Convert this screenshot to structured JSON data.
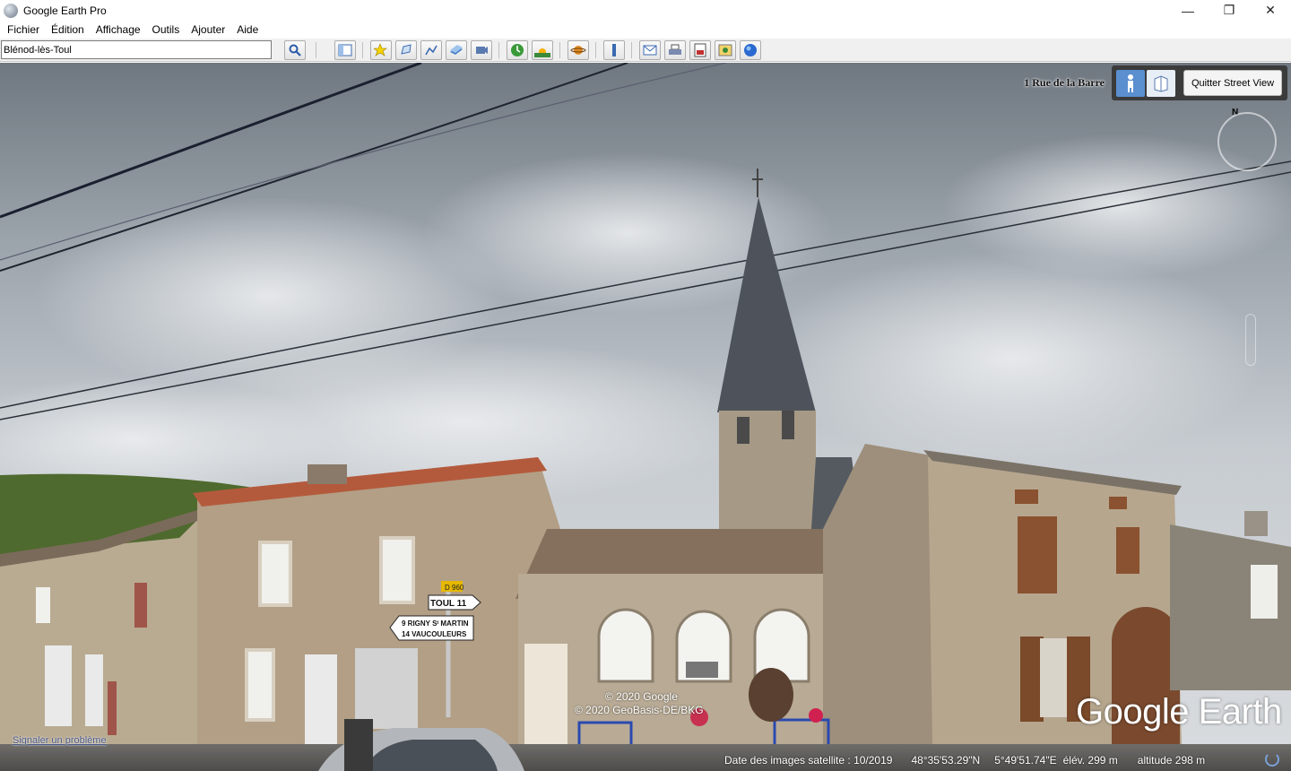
{
  "window": {
    "title": "Google Earth Pro",
    "minimize": "—",
    "restore": "❐",
    "close": "✕"
  },
  "menu": [
    "Fichier",
    "Édition",
    "Affichage",
    "Outils",
    "Ajouter",
    "Aide"
  ],
  "toolbar": {
    "search_value": "Blénod-lès-Toul",
    "buttons": [
      "search-icon",
      "sidebar-icon",
      "placemark-icon",
      "polygon-icon",
      "path-icon",
      "overlay-icon",
      "tour-icon",
      "historical-imagery-icon",
      "sunlight-icon",
      "planets-icon",
      "ruler-icon",
      "email-icon",
      "print-icon",
      "save-image-icon",
      "maps-icon",
      "earth-gallery-icon"
    ]
  },
  "street_view": {
    "address": "1 Rue de la Barre",
    "exit_label": "Quitter Street View",
    "compass_label": "N"
  },
  "overlay": {
    "copyright_1": "© 2020 Google",
    "copyright_2": "© 2020 GeoBasis-DE/BKG",
    "logo": "Google Earth",
    "report_link": "Signaler un problème"
  },
  "status": {
    "imagery_date": "Date des images satellite : 10/2019",
    "latitude": "48°35'53.29\"N",
    "longitude": "5°49'51.74\"E",
    "elevation": "élév.   299 m",
    "altitude": "altitude     298 m"
  },
  "scene": {
    "road_signs": {
      "route": "D 960",
      "sign1": "TOUL   11",
      "sign2_line1": "9   RIGNY Sᵗ MARTIN",
      "sign2_line2": "14   VAUCOULEURS"
    }
  }
}
